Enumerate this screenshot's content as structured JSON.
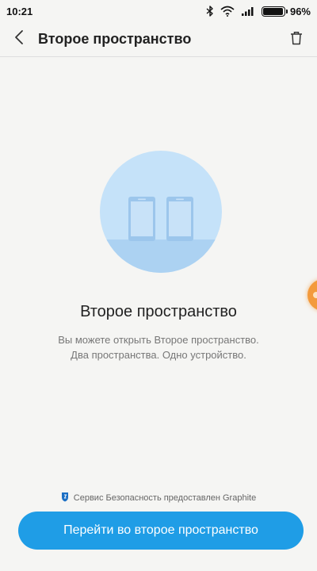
{
  "status_bar": {
    "time": "10:21",
    "battery_percent": "96%",
    "battery_level": 0.96,
    "icons": [
      "bluetooth-icon",
      "wifi-icon",
      "cell-signal-icon",
      "battery-icon"
    ]
  },
  "header": {
    "title": "Второе пространство",
    "back_icon": "back-arrow-icon",
    "delete_icon": "trash-icon"
  },
  "illustration": {
    "icon": "two-phones-icon",
    "circle_color": "#c5e2f9",
    "floor_color": "#acd2f2",
    "phone_color": "#9cc6ec"
  },
  "main": {
    "title": "Второе пространство",
    "description_line1": "Вы можете открыть Второе пространство.",
    "description_line2": "Два пространства. Одно устройство."
  },
  "footer": {
    "provider_icon": "shield-icon",
    "provider_text": "Сервис Безопасность предоставлен Graphite",
    "button_label": "Перейти во второе пространство",
    "button_color": "#1f9de6"
  },
  "edge_handle_color": "#f39a3c"
}
